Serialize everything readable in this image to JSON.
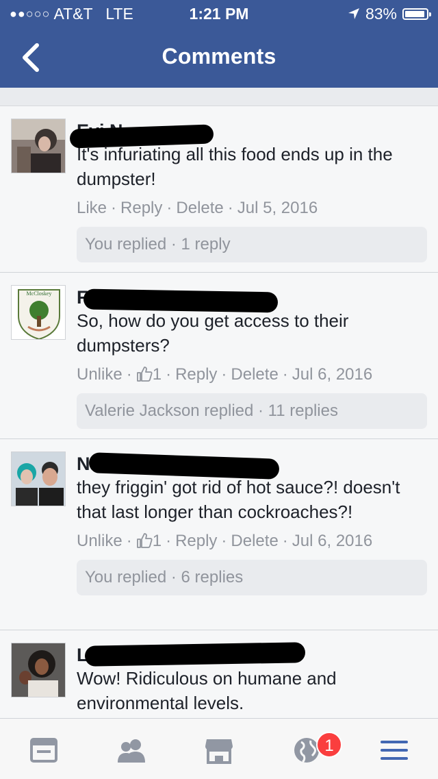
{
  "status_bar": {
    "signal": "●●○○○",
    "carrier": "AT&T",
    "network": "LTE",
    "time": "1:21 PM",
    "battery": "83%"
  },
  "nav": {
    "title": "Comments",
    "back_icon": "chevron-left-icon"
  },
  "comments": [
    {
      "name": "Evi Numan",
      "text": "It's infuriating all this food ends up in the dumpster!",
      "like": "Like",
      "like_count": "",
      "reply": "Reply",
      "delete": "Delete",
      "date": "Jul 5, 2016",
      "replies": "You replied · 1 reply"
    },
    {
      "name": "F",
      "avatar_label": "McCloskey",
      "text": "So, how do you get access to their dumpsters?",
      "like": "Unlike",
      "like_count": "1",
      "reply": "Reply",
      "delete": "Delete",
      "date": "Jul 6, 2016",
      "replies": "Valerie Jackson replied · 11 replies"
    },
    {
      "name": "N",
      "text": "they friggin' got rid of hot sauce?! doesn't that last longer than cockroaches?!",
      "like": "Unlike",
      "like_count": "1",
      "reply": "Reply",
      "delete": "Delete",
      "date": "Jul 6, 2016",
      "replies": "You replied · 6 replies"
    },
    {
      "name": "L",
      "text": "Wow! Ridiculous on humane and environmental levels."
    }
  ],
  "tabbar": {
    "items": [
      "news-feed-icon",
      "friends-icon",
      "marketplace-icon",
      "notifications-globe-icon",
      "menu-icon"
    ],
    "notification_badge": "1"
  },
  "colors": {
    "brand": "#3b5998",
    "accent": "#4267b2",
    "badge": "#fa3e3e"
  }
}
